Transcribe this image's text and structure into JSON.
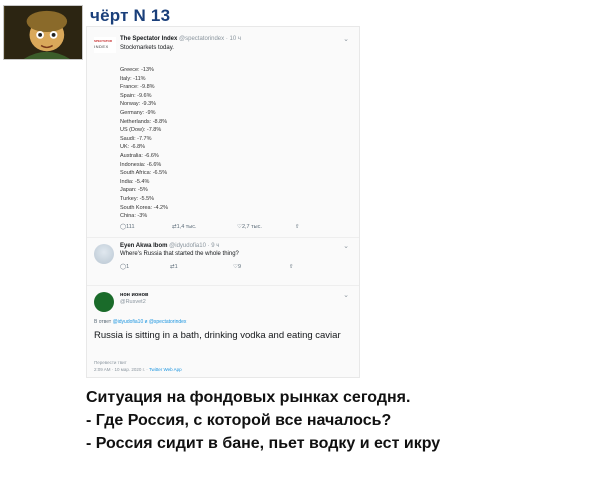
{
  "post": {
    "username": "чёрт N 13",
    "caption_lines": [
      "Ситуация на фондовых рынках сегодня.",
      "- Где Россия, с которой все началось?",
      "- Россия сидит в бане, пьет водку и ест икру"
    ]
  },
  "tweets": {
    "main": {
      "logo_line1": "SPECTATOR",
      "logo_line2": "INDEX",
      "name": "The Spectator Index",
      "handle": "@spectatorindex · 10 ч",
      "text": "Stockmarkets today.",
      "items": [
        "Greece: -13%",
        "Italy: -11%",
        "France: -9.8%",
        "Spain: -9.6%",
        "Norway: -9.3%",
        "Germany: -9%",
        "Netherlands: -8.8%",
        "US (Dow): -7.8%",
        "Saudi: -7.7%",
        "UK: -6.8%",
        "Australia: -6.6%",
        "Indonesia: -6.6%",
        "South Africa: -6.5%",
        "India: -5.4%",
        "Japan: -5%",
        "Turkey: -5.5%",
        "South Korea: -4.2%",
        "China: -3%"
      ],
      "replies": "111",
      "retweets": "1,4 тыс.",
      "likes": "2,7 тыс."
    },
    "reply1": {
      "name": "Eyen Akwa Ibom",
      "handle": "@idyudofia10 · 9 ч",
      "text": "Where's Russia that started the whole thing?",
      "replies": "1",
      "retweets": "1",
      "likes": "9"
    },
    "reply2": {
      "name": "нон ионов",
      "handle": "@Rusvet2",
      "reply_prefix": "В ответ",
      "reply_targets": "@idyudofia10 и @spectatorindex",
      "text": "Russia is sitting in a bath, drinking vodka and eating caviar",
      "translate": "Перевести твит",
      "time": "2:09 AM · 10 мар. 2020 г. · ",
      "client": "Twitter Web App"
    }
  },
  "colors": {
    "username": "#1a3f7a",
    "link": "#1b95e0",
    "muted": "#8a959e"
  }
}
